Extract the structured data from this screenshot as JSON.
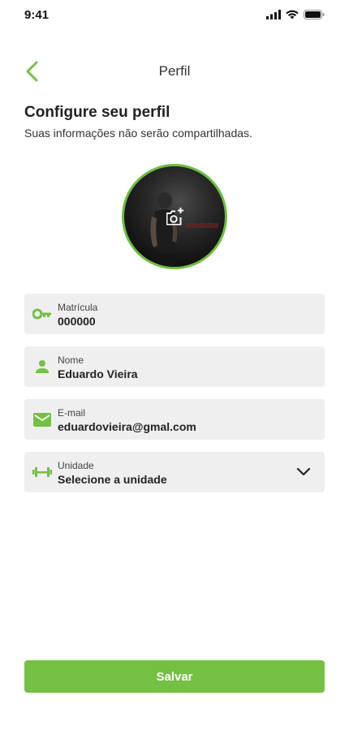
{
  "status_bar": {
    "time": "9:41"
  },
  "header": {
    "title": "Perfil"
  },
  "intro": {
    "title": "Configure seu perfil",
    "subtitle": "Suas informações não serão compartilhadas."
  },
  "fields": {
    "registration": {
      "label": "Matrícula",
      "value": "000000",
      "icon": "key-icon"
    },
    "name": {
      "label": "Nome",
      "value": "Eduardo Vieira",
      "icon": "person-icon"
    },
    "email": {
      "label": "E-mail",
      "value": "eduardovieira@gmal.com",
      "icon": "mail-icon"
    },
    "unit": {
      "label": "Unidade",
      "value": "Selecione a unidade",
      "icon": "dumbbell-icon"
    }
  },
  "actions": {
    "save_label": "Salvar"
  },
  "colors": {
    "accent": "#74c043",
    "field_bg": "#efefef"
  }
}
